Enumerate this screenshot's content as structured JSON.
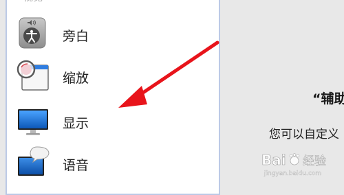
{
  "sidebar": {
    "section_header": "视觉",
    "items": [
      {
        "label": "旁白",
        "icon": "voiceover-accessibility-icon"
      },
      {
        "label": "缩放",
        "icon": "zoom-magnifier-icon"
      },
      {
        "label": "显示",
        "icon": "display-monitor-icon"
      },
      {
        "label": "语音",
        "icon": "speech-monitor-icon"
      }
    ]
  },
  "main": {
    "title": "“辅助",
    "description": "您可以自定义"
  },
  "watermark": {
    "text": "Bai",
    "brand": "经验",
    "sub": "jingyan.baidu.com"
  },
  "colors": {
    "arrow": "#e8141b",
    "sidebar_border": "#bcc9e6",
    "display_blue": "#1c6fd6"
  }
}
